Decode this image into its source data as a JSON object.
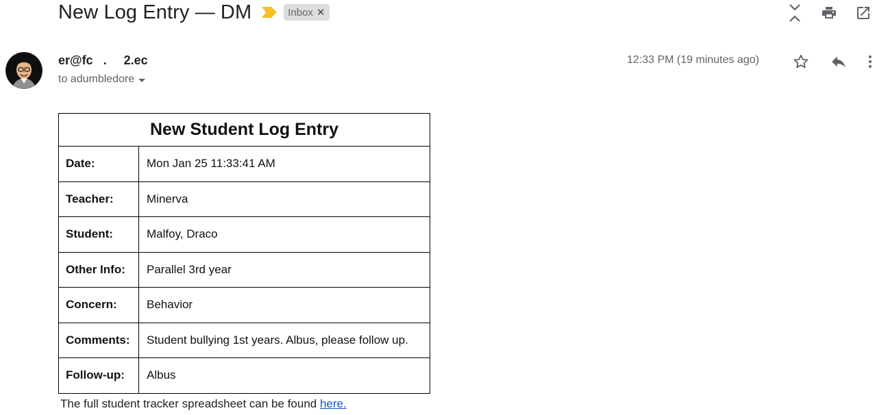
{
  "email": {
    "subject": "New Log Entry — DM",
    "label": "Inbox",
    "sender": "er@fc   .     2.ec",
    "recipient": "to adumbledore",
    "timestamp": "12:33 PM (19 minutes ago)"
  },
  "table": {
    "title": "New Student Log Entry",
    "rows": [
      {
        "key": "Date:",
        "value": "Mon Jan 25 11:33:41 AM"
      },
      {
        "key": "Teacher:",
        "value": "Minerva"
      },
      {
        "key": "Student:",
        "value": "Malfoy, Draco"
      },
      {
        "key": "Other Info:",
        "value": "Parallel 3rd year"
      },
      {
        "key": "Concern:",
        "value": "Behavior"
      },
      {
        "key": "Comments:",
        "value": "Student bullying 1st years. Albus, please follow up."
      },
      {
        "key": "Follow-up:",
        "value": "Albus"
      }
    ]
  },
  "footer": {
    "text": "The full student tracker spreadsheet can be found ",
    "link_text": "here."
  },
  "colors": {
    "importance_marker": "#f6c026",
    "link": "#1155cc",
    "icon": "#5f6368"
  },
  "icons": [
    "importance-marker-icon",
    "collapse-all-icon",
    "print-icon",
    "open-in-new-window-icon",
    "star-icon",
    "reply-icon",
    "more-options-icon",
    "dropdown-caret-icon"
  ]
}
